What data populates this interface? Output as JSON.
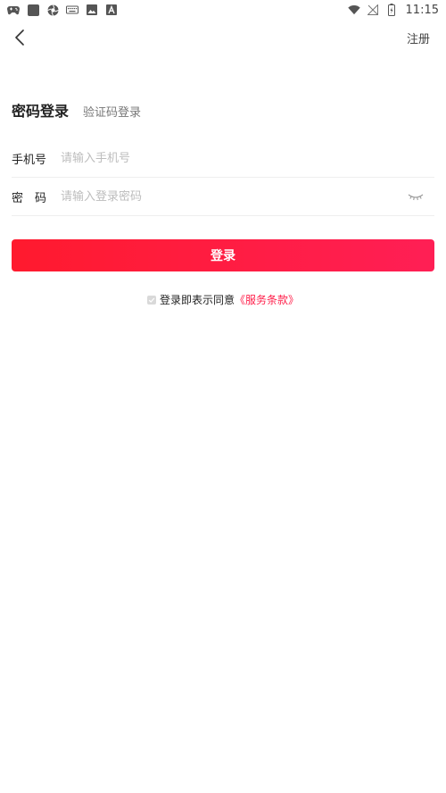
{
  "status_bar": {
    "time": "11:15",
    "left_icons": [
      "gamepad-icon",
      "app-square-icon",
      "aperture-icon",
      "keyboard-icon",
      "image-icon",
      "font-icon"
    ],
    "right_icons": [
      "wifi-icon",
      "no-signal-icon",
      "battery-charging-icon"
    ]
  },
  "nav": {
    "register_label": "注册"
  },
  "tabs": {
    "active": "密码登录",
    "inactive": "验证码登录"
  },
  "form": {
    "phone_label": "手机号",
    "phone_placeholder": "请输入手机号",
    "phone_value": "",
    "password_label": "密码",
    "password_placeholder": "请输入登录密码",
    "password_value": ""
  },
  "login_button_label": "登录",
  "agreement": {
    "text": "登录即表示同意",
    "link": "《服务条款》"
  },
  "colors": {
    "accent_start": "#ff1a2e",
    "accent_end": "#ff1f55",
    "link": "#ff1f4a"
  }
}
